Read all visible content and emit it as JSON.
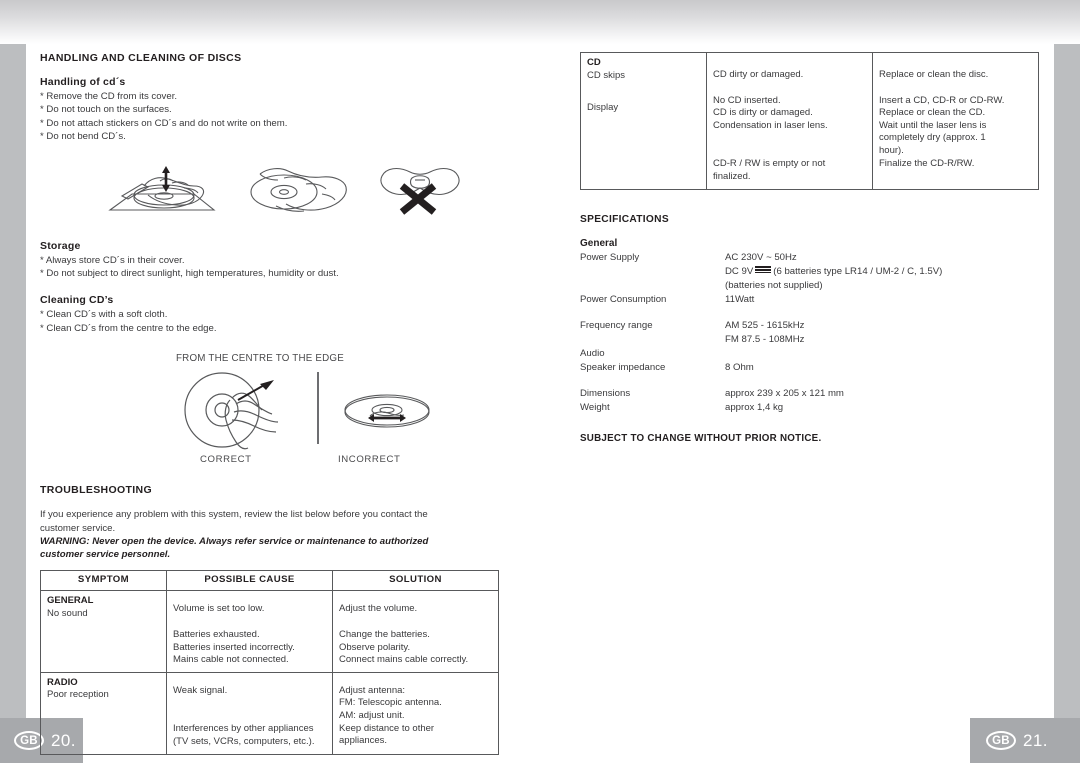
{
  "page_chrome": {
    "left_badge": {
      "region_code": "GB",
      "page_number": "20."
    },
    "right_badge": {
      "region_code": "GB",
      "page_number": "21."
    }
  },
  "left_page": {
    "section_title": "HANDLING AND CLEANING OF DISCS",
    "handling": {
      "heading": "Handling of cd´s",
      "bullets": [
        "* Remove the CD from its cover.",
        "* Do not touch on the surfaces.",
        "* Do not attach stickers on CD´s and do not write on them.",
        "* Do not bend CD´s."
      ],
      "illustrations": [
        "cd-eject-from-tray-illustration",
        "cd-hold-by-edges-illustration",
        "cd-do-not-bend-illustration"
      ]
    },
    "storage": {
      "heading": "Storage",
      "bullets": [
        "* Always store CD´s in their cover.",
        "* Do not subject to direct sunlight, high temperatures, humidity or dust."
      ]
    },
    "cleaning": {
      "heading": "Cleaning CD’s",
      "bullets": [
        "* Clean CD´s with a soft cloth.",
        "* Clean CD´s from the centre to the edge."
      ],
      "figure_caption": "FROM THE CENTRE TO THE EDGE",
      "correct_label": "CORRECT",
      "incorrect_label": "INCORRECT"
    },
    "troubleshooting": {
      "heading": "TROUBLESHOOTING",
      "intro": "If you experience any problem with this system, review the list below before you contact the customer service.",
      "warning": "WARNING: Never open the device. Always refer service or maintenance to authorized customer service personnel.",
      "table": {
        "columns": [
          "SYMPTOM",
          "POSSIBLE CAUSE",
          "SOLUTION"
        ],
        "rows": [
          {
            "symptom_head": "GENERAL",
            "symptom_sub": "No sound",
            "cause_group_1": [
              "Volume is set too low."
            ],
            "solution_group_1": [
              "Adjust the volume."
            ],
            "cause_group_2": [
              "Batteries exhausted.",
              "Batteries inserted incorrectly.",
              "Mains cable not connected."
            ],
            "solution_group_2": [
              "Change the batteries.",
              "Observe polarity.",
              "Connect mains cable correctly."
            ]
          },
          {
            "symptom_head": "RADIO",
            "symptom_sub": "Poor reception",
            "cause_group_1": [
              "Weak signal."
            ],
            "solution_group_1": [
              "Adjust antenna:",
              "FM: Telescopic antenna.",
              "AM: adjust unit."
            ],
            "cause_group_2": [
              "Interferences by other appliances",
              "(TV sets, VCRs, computers, etc.)."
            ],
            "solution_group_2": [
              "Keep distance to other",
              "appliances."
            ]
          }
        ]
      }
    }
  },
  "right_page": {
    "cd_table": {
      "rows": [
        {
          "symptom_head": "CD",
          "symptom_sub": "CD skips",
          "cause_group_1": [
            "CD dirty or damaged."
          ],
          "solution_group_1": [
            "Replace or clean the disc."
          ],
          "symptom_2": "Display",
          "cause_group_2": [
            "No CD inserted.",
            "CD is dirty or damaged.",
            "Condensation in laser lens."
          ],
          "solution_group_2": [
            "Insert a CD, CD-R or CD-RW.",
            "Replace or clean the CD.",
            "Wait until the laser lens is",
            "completely dry (approx. 1",
            "hour)."
          ],
          "cause_group_3": [
            "CD-R / RW is empty or not",
            "finalized."
          ],
          "solution_group_3": [
            "Finalize the CD-R/RW."
          ]
        }
      ]
    },
    "specifications": {
      "heading": "SPECIFICATIONS",
      "group_label": "General",
      "items": [
        {
          "key": "Power Supply",
          "values": [
            "AC 230V ~ 50Hz"
          ]
        },
        {
          "key": "",
          "values": [
            "DC 9V ⎓ (6 batteries type LR14 / UM-2 / C, 1.5V)",
            "(batteries not supplied)"
          ],
          "dc_symbol": true
        },
        {
          "key": "Power Consumption",
          "values": [
            "11Watt"
          ]
        },
        {
          "key": "",
          "values": [
            ""
          ],
          "spacer": true
        },
        {
          "key": "Frequency range",
          "values": [
            "AM 525 - 1615kHz",
            "FM 87.5 - 108MHz"
          ]
        },
        {
          "key": "Audio",
          "values": [
            ""
          ]
        },
        {
          "key": "Speaker impedance",
          "values": [
            "8 Ohm"
          ]
        },
        {
          "key": "",
          "values": [
            ""
          ],
          "spacer": true
        },
        {
          "key": "Dimensions",
          "values": [
            "approx 239 x 205 x 121 mm"
          ]
        },
        {
          "key": "Weight",
          "values": [
            "approx 1,4 kg"
          ]
        }
      ],
      "dc_prefix": "DC 9V",
      "dc_suffix": "(6 batteries type LR14 / UM-2 / C, 1.5V)",
      "dc_second_line": "(batteries not supplied)",
      "notice": "SUBJECT TO CHANGE WITHOUT PRIOR NOTICE."
    }
  }
}
